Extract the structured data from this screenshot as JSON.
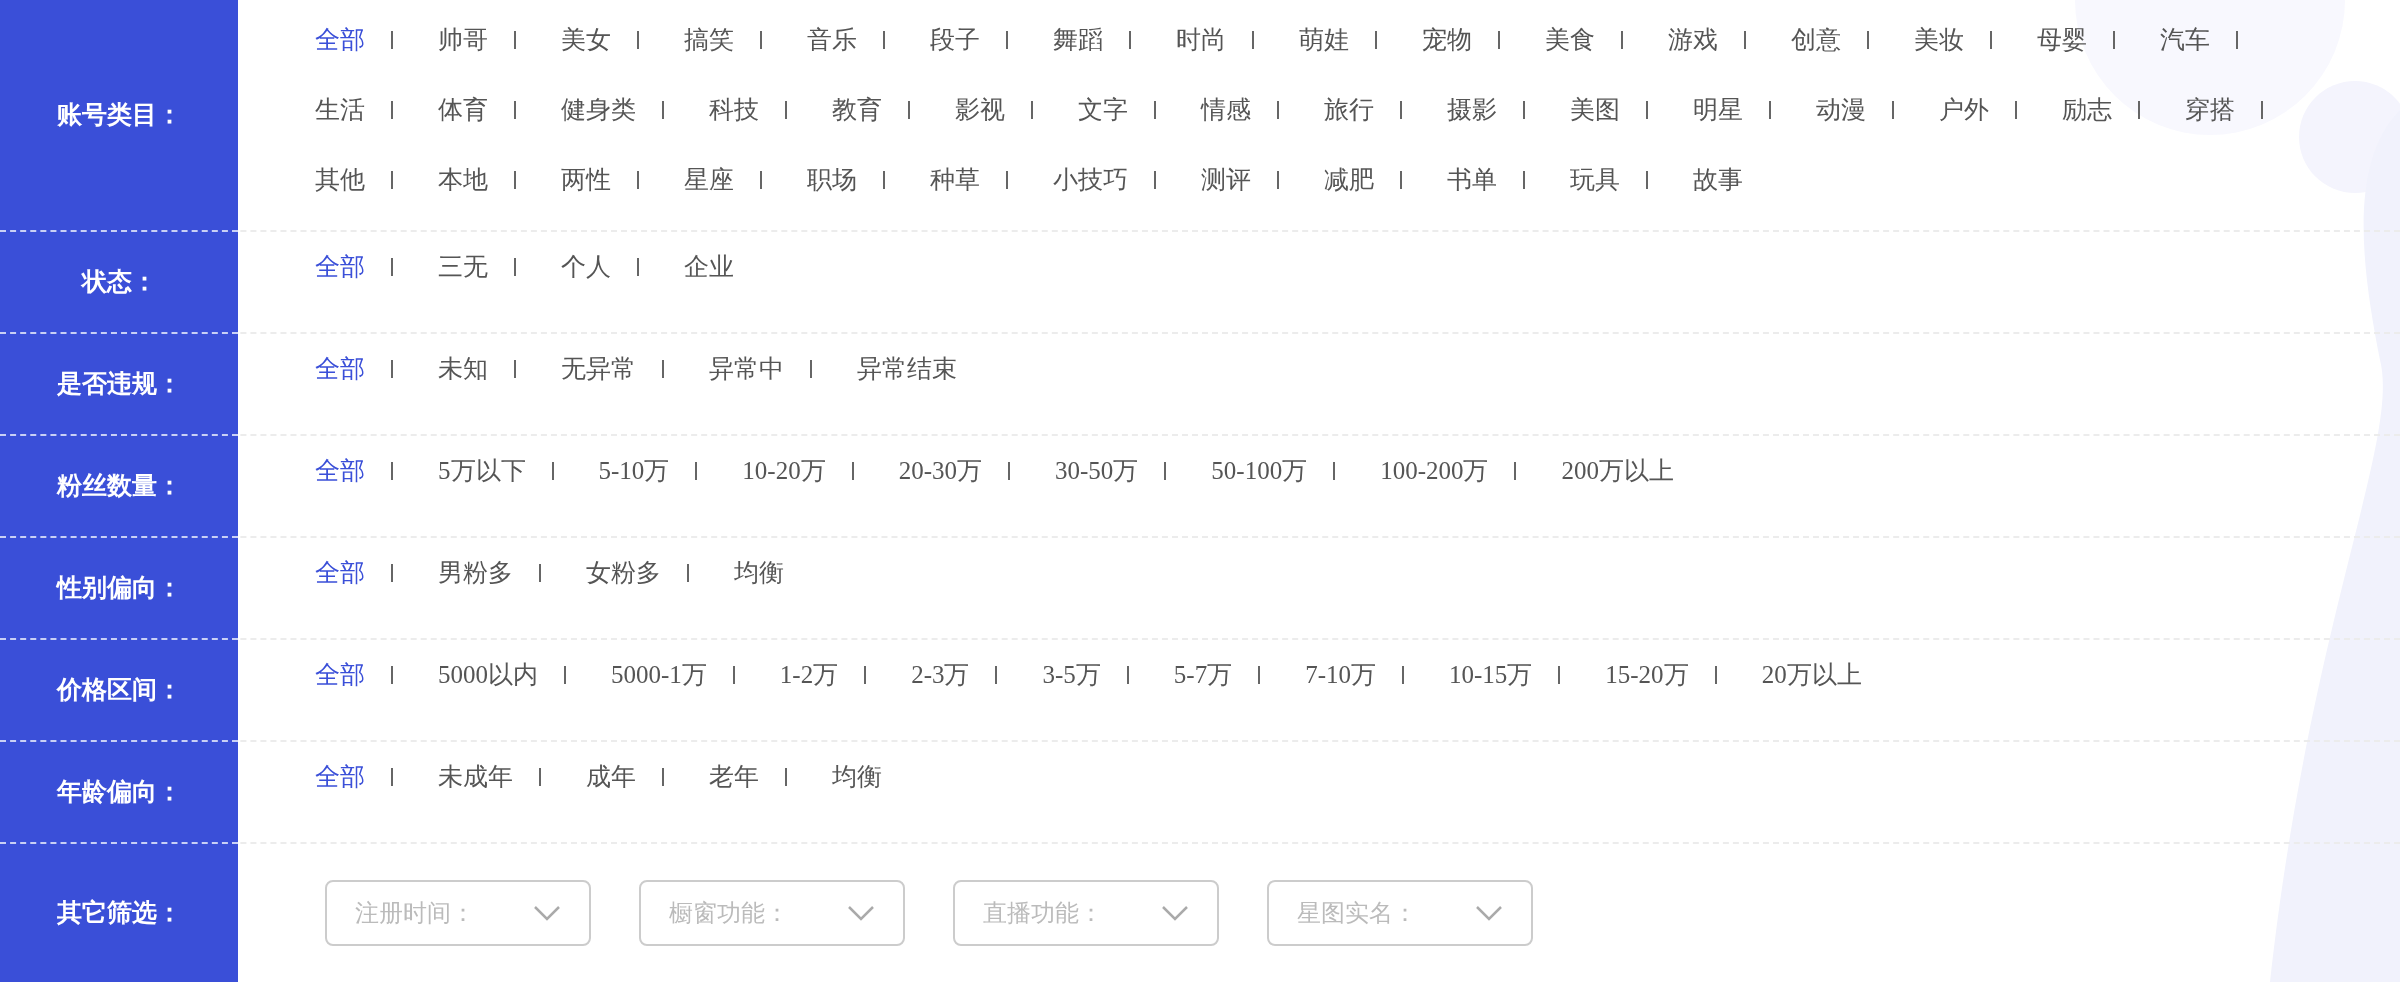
{
  "filters": [
    {
      "label": "账号类目：",
      "options": [
        {
          "text": "全部",
          "selected": true
        },
        {
          "text": "帅哥",
          "selected": false
        },
        {
          "text": "美女",
          "selected": false
        },
        {
          "text": "搞笑",
          "selected": false
        },
        {
          "text": "音乐",
          "selected": false
        },
        {
          "text": "段子",
          "selected": false
        },
        {
          "text": "舞蹈",
          "selected": false
        },
        {
          "text": "时尚",
          "selected": false
        },
        {
          "text": "萌娃",
          "selected": false
        },
        {
          "text": "宠物",
          "selected": false
        },
        {
          "text": "美食",
          "selected": false
        },
        {
          "text": "游戏",
          "selected": false
        },
        {
          "text": "创意",
          "selected": false
        },
        {
          "text": "美妆",
          "selected": false
        },
        {
          "text": "母婴",
          "selected": false
        },
        {
          "text": "汽车",
          "selected": false
        },
        {
          "text": "生活",
          "selected": false
        },
        {
          "text": "体育",
          "selected": false
        },
        {
          "text": "健身类",
          "selected": false
        },
        {
          "text": "科技",
          "selected": false
        },
        {
          "text": "教育",
          "selected": false
        },
        {
          "text": "影视",
          "selected": false
        },
        {
          "text": "文字",
          "selected": false
        },
        {
          "text": "情感",
          "selected": false
        },
        {
          "text": "旅行",
          "selected": false
        },
        {
          "text": "摄影",
          "selected": false
        },
        {
          "text": "美图",
          "selected": false
        },
        {
          "text": "明星",
          "selected": false
        },
        {
          "text": "动漫",
          "selected": false
        },
        {
          "text": "户外",
          "selected": false
        },
        {
          "text": "励志",
          "selected": false
        },
        {
          "text": "穿搭",
          "selected": false
        },
        {
          "text": "其他",
          "selected": false
        },
        {
          "text": "本地",
          "selected": false
        },
        {
          "text": "两性",
          "selected": false
        },
        {
          "text": "星座",
          "selected": false
        },
        {
          "text": "职场",
          "selected": false
        },
        {
          "text": "种草",
          "selected": false
        },
        {
          "text": "小技巧",
          "selected": false
        },
        {
          "text": "测评",
          "selected": false
        },
        {
          "text": "减肥",
          "selected": false
        },
        {
          "text": "书单",
          "selected": false
        },
        {
          "text": "玩具",
          "selected": false
        },
        {
          "text": "故事",
          "selected": false
        }
      ]
    },
    {
      "label": "状态：",
      "options": [
        {
          "text": "全部",
          "selected": true
        },
        {
          "text": "三无",
          "selected": false
        },
        {
          "text": "个人",
          "selected": false
        },
        {
          "text": "企业",
          "selected": false
        }
      ]
    },
    {
      "label": "是否违规：",
      "options": [
        {
          "text": "全部",
          "selected": true
        },
        {
          "text": "未知",
          "selected": false
        },
        {
          "text": "无异常",
          "selected": false
        },
        {
          "text": "异常中",
          "selected": false
        },
        {
          "text": "异常结束",
          "selected": false
        }
      ]
    },
    {
      "label": "粉丝数量：",
      "options": [
        {
          "text": "全部",
          "selected": true
        },
        {
          "text": "5万以下",
          "selected": false
        },
        {
          "text": "5-10万",
          "selected": false
        },
        {
          "text": "10-20万",
          "selected": false
        },
        {
          "text": "20-30万",
          "selected": false
        },
        {
          "text": "30-50万",
          "selected": false
        },
        {
          "text": "50-100万",
          "selected": false
        },
        {
          "text": "100-200万",
          "selected": false
        },
        {
          "text": "200万以上",
          "selected": false
        }
      ]
    },
    {
      "label": "性别偏向：",
      "options": [
        {
          "text": "全部",
          "selected": true
        },
        {
          "text": "男粉多",
          "selected": false
        },
        {
          "text": "女粉多",
          "selected": false
        },
        {
          "text": "均衡",
          "selected": false
        }
      ]
    },
    {
      "label": "价格区间：",
      "options": [
        {
          "text": "全部",
          "selected": true
        },
        {
          "text": "5000以内",
          "selected": false
        },
        {
          "text": "5000-1万",
          "selected": false
        },
        {
          "text": "1-2万",
          "selected": false
        },
        {
          "text": "2-3万",
          "selected": false
        },
        {
          "text": "3-5万",
          "selected": false
        },
        {
          "text": "5-7万",
          "selected": false
        },
        {
          "text": "7-10万",
          "selected": false
        },
        {
          "text": "10-15万",
          "selected": false
        },
        {
          "text": "15-20万",
          "selected": false
        },
        {
          "text": "20万以上",
          "selected": false
        }
      ]
    },
    {
      "label": "年龄偏向：",
      "options": [
        {
          "text": "全部",
          "selected": true
        },
        {
          "text": "未成年",
          "selected": false
        },
        {
          "text": "成年",
          "selected": false
        },
        {
          "text": "老年",
          "selected": false
        },
        {
          "text": "均衡",
          "selected": false
        }
      ]
    }
  ],
  "other_filters": {
    "label": "其它筛选：",
    "dropdowns": [
      {
        "placeholder": "注册时间："
      },
      {
        "placeholder": "橱窗功能："
      },
      {
        "placeholder": "直播功能："
      },
      {
        "placeholder": "星图实名："
      }
    ]
  }
}
